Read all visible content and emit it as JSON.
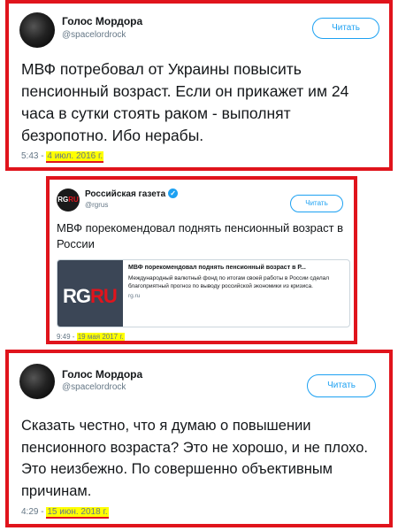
{
  "tweets": [
    {
      "author_name": "Голос Мордора",
      "handle": "@spacelordrock",
      "follow_label": "Читать",
      "text": "МВФ потребовал от Украины повысить пенсионный возраст. Если он прикажет им 24 часа в сутки стоять раком - выполнят безропотно. Ибо нерабы.",
      "time": "5:43 -",
      "date": "4 июл. 2016 г."
    },
    {
      "author_name": "Российская газета",
      "verified_mark": "✓",
      "handle": "@rgrus",
      "follow_label": "Читать",
      "avatar_text_a": "RG",
      "avatar_text_b": "RU",
      "text": "МВФ порекомендовал поднять пенсионный возраст в России",
      "card": {
        "logo_a": "RG",
        "logo_b": "RU",
        "title": "МВФ порекомендовал поднять пенсионный возраст в Р...",
        "description": "Международный валютный фонд по итогам своей работы в России сделал благоприятный прогноз по выводу российской экономики из кризиса.",
        "domain": "rg.ru"
      },
      "time": "9:49 -",
      "date": "19 мая 2017 г."
    },
    {
      "author_name": "Голос Мордора",
      "handle": "@spacelordrock",
      "follow_label": "Читать",
      "text": "Сказать честно, что я думаю о повышении пенсионного возраста? Это не хорошо, и не плохо. Это неизбежно. По совершенно объективным причинам.",
      "time": "4:29 -",
      "date": "15 июн. 2018 г."
    }
  ],
  "colors": {
    "frame": "#e0141c",
    "highlight": "#ffff00",
    "link": "#1da1f2",
    "muted": "#657786"
  }
}
